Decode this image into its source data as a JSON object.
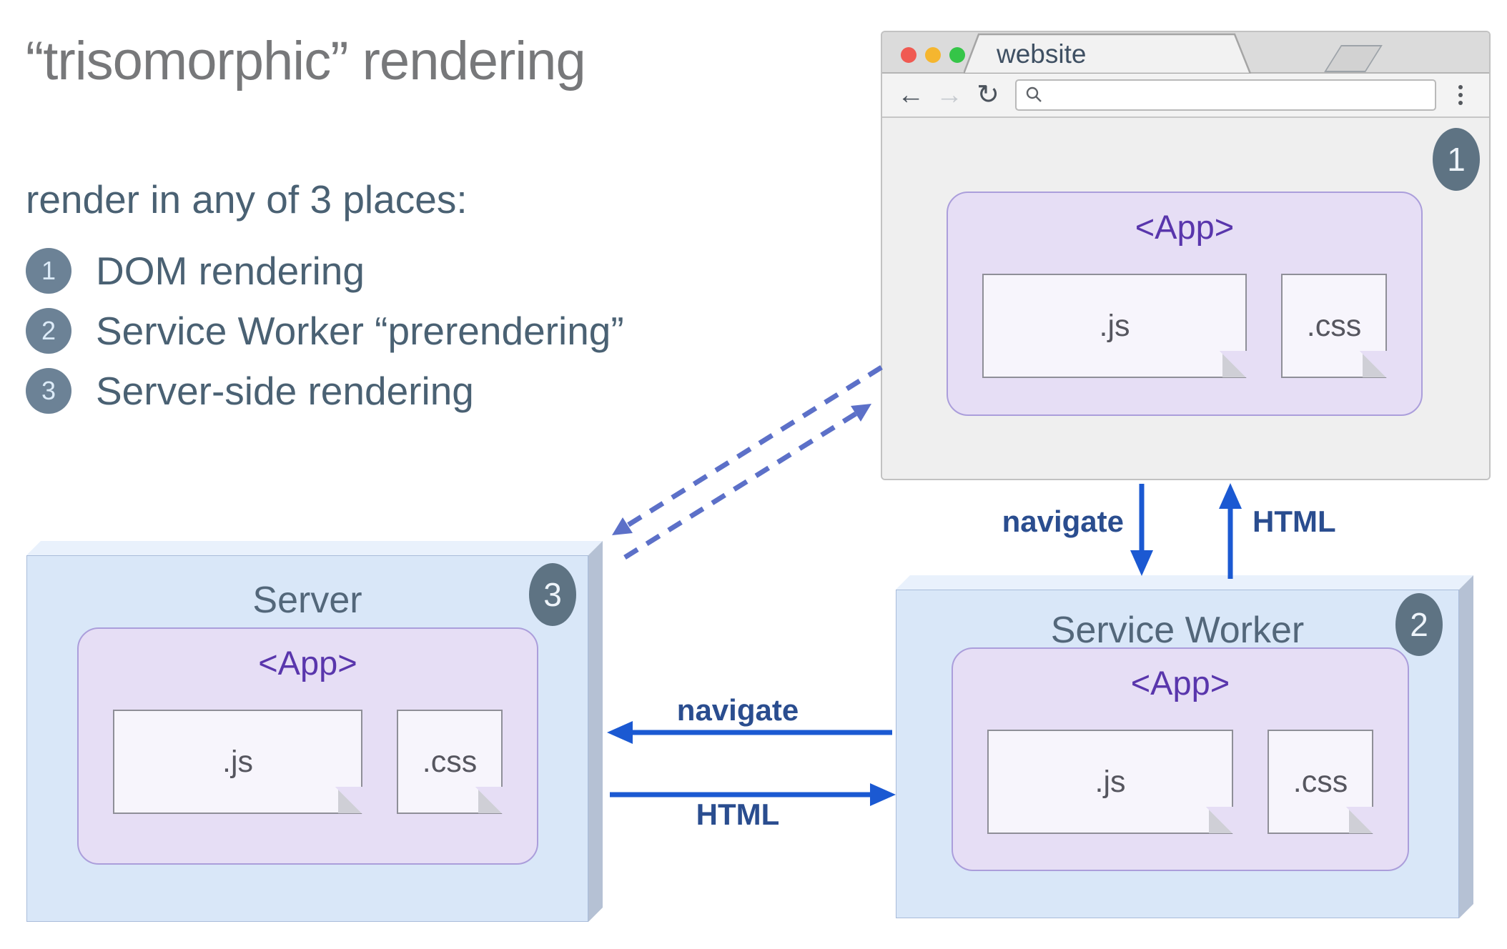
{
  "colors": {
    "arrow_blue": "#1b59d2",
    "dashed_arrow": "#5c70c8",
    "arrow_label": "#2a4d8f",
    "badge_slate": "#5e7383",
    "list_badge": "#6c8296",
    "app_purple": "#5936ac",
    "box_face_blue": "#d9e7f8",
    "lavender": "#e6def5",
    "title_gray": "#77787a",
    "body_slate": "#4a6173"
  },
  "intro": {
    "title": "“trisomorphic” rendering",
    "subtitle": "render in any of 3 places:",
    "items": [
      {
        "num": "1",
        "label": "DOM rendering"
      },
      {
        "num": "2",
        "label": "Service Worker “prerendering”"
      },
      {
        "num": "3",
        "label": "Server-side rendering"
      }
    ]
  },
  "browser": {
    "tab_title": "website",
    "badge": "1",
    "app": {
      "label": "<App>",
      "files": [
        {
          "name": ".js"
        },
        {
          "name": ".css"
        }
      ]
    }
  },
  "server": {
    "title": "Server",
    "badge": "3",
    "app": {
      "label": "<App>",
      "files": [
        {
          "name": ".js"
        },
        {
          "name": ".css"
        }
      ]
    }
  },
  "service_worker": {
    "title": "Service Worker",
    "badge": "2",
    "app": {
      "label": "<App>",
      "files": [
        {
          "name": ".js"
        },
        {
          "name": ".css"
        }
      ]
    }
  },
  "arrows": {
    "navigate_down": "navigate",
    "html_up": "HTML",
    "navigate_left": "navigate",
    "html_right": "HTML"
  }
}
